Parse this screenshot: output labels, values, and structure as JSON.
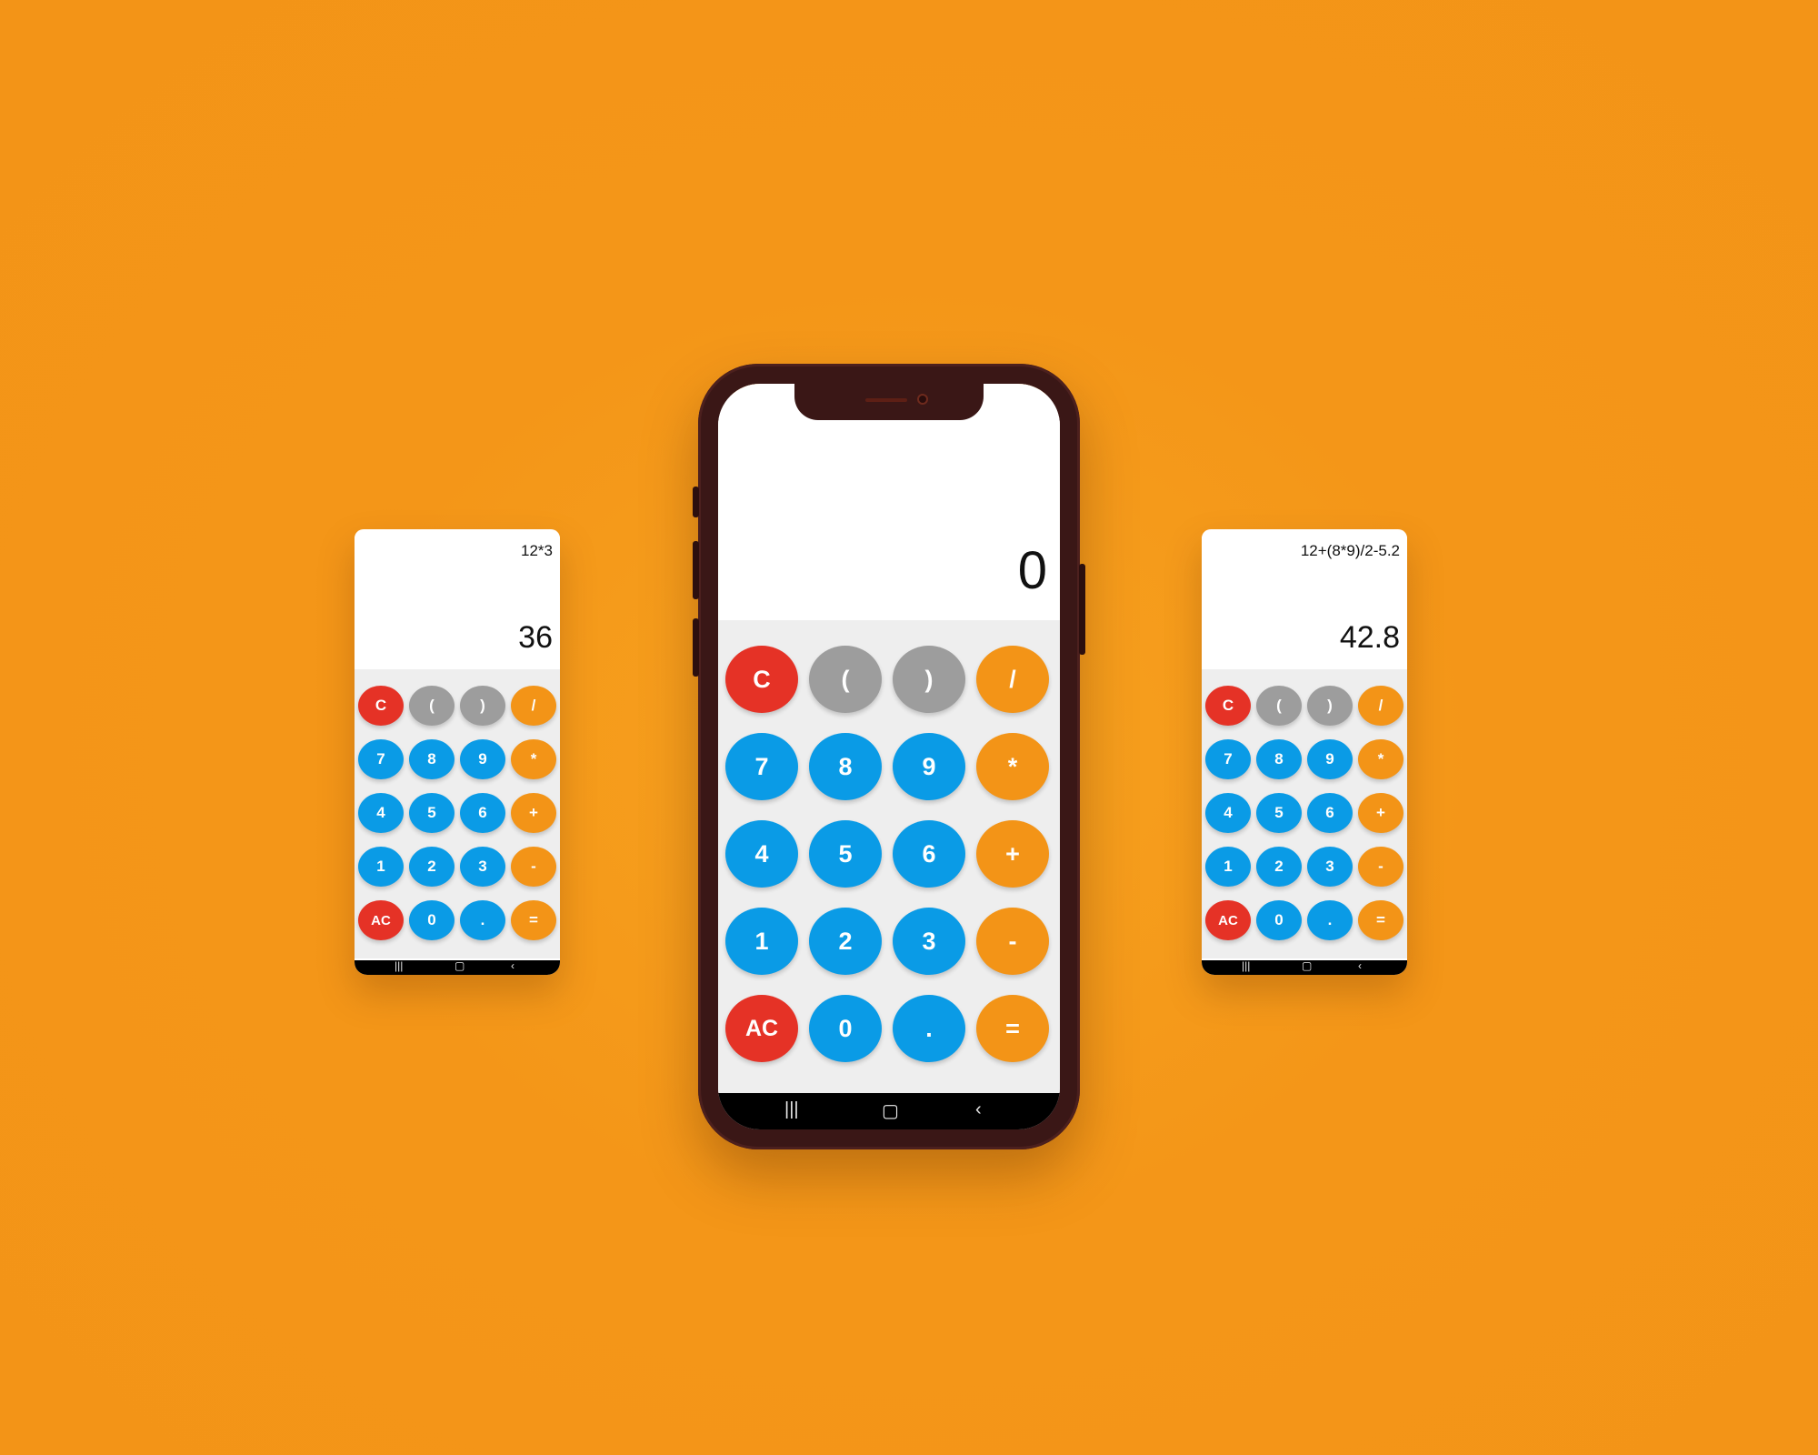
{
  "colors": {
    "background": "#f49618",
    "key_clear": "#e53226",
    "key_paren": "#9d9d9d",
    "key_digit": "#0a9be6",
    "key_operator": "#f39417",
    "keypad_bg": "#eeeeee",
    "phone_frame": "#3a1716"
  },
  "keys": [
    [
      {
        "label": "C",
        "kind": "red"
      },
      {
        "label": "(",
        "kind": "gray"
      },
      {
        "label": ")",
        "kind": "gray"
      },
      {
        "label": "/",
        "kind": "orange"
      }
    ],
    [
      {
        "label": "7",
        "kind": "blue"
      },
      {
        "label": "8",
        "kind": "blue"
      },
      {
        "label": "9",
        "kind": "blue"
      },
      {
        "label": "*",
        "kind": "orange"
      }
    ],
    [
      {
        "label": "4",
        "kind": "blue"
      },
      {
        "label": "5",
        "kind": "blue"
      },
      {
        "label": "6",
        "kind": "blue"
      },
      {
        "label": "+",
        "kind": "orange"
      }
    ],
    [
      {
        "label": "1",
        "kind": "blue"
      },
      {
        "label": "2",
        "kind": "blue"
      },
      {
        "label": "3",
        "kind": "blue"
      },
      {
        "label": "-",
        "kind": "orange"
      }
    ],
    [
      {
        "label": "AC",
        "kind": "red"
      },
      {
        "label": "0",
        "kind": "blue"
      },
      {
        "label": ".",
        "kind": "blue"
      },
      {
        "label": "=",
        "kind": "orange"
      }
    ]
  ],
  "nav_icons": [
    "recent-apps-icon",
    "home-icon",
    "back-icon"
  ],
  "nav_glyphs": [
    "|||",
    "▢",
    "‹"
  ],
  "phones": {
    "left": {
      "expression": "12*3",
      "result": "36"
    },
    "center": {
      "expression": "",
      "result": "0"
    },
    "right": {
      "expression": "12+(8*9)/2-5.2",
      "result": "42.8"
    }
  }
}
